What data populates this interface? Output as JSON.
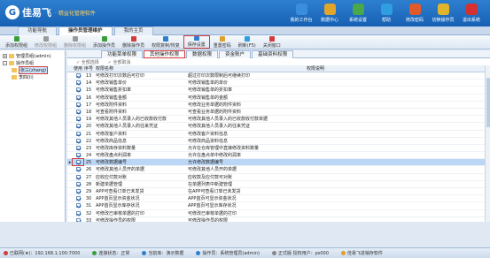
{
  "header": {
    "logo_mark": "G",
    "app_name": "佳易飞",
    "slogan": "· 精益化管理软件",
    "nav": [
      {
        "label": "我的工作台",
        "color": "#3b8de0"
      },
      {
        "label": "数据中心",
        "color": "#e2a52b"
      },
      {
        "label": "系统设置",
        "color": "#4aa84a"
      },
      {
        "label": "帮助",
        "color": "#2f9ee0"
      },
      {
        "label": "修改密码",
        "color": "#e05a2b"
      },
      {
        "label": "切换操作员",
        "color": "#e0b52b"
      },
      {
        "label": "退出系统",
        "color": "#d63030"
      }
    ]
  },
  "tabs": [
    "功能导航",
    "操作员管理维护",
    "我的主页"
  ],
  "toolbar": [
    {
      "label": "添加权限组",
      "dim": false,
      "color": "#3a9d3a"
    },
    {
      "label": "修改权限组",
      "dim": true,
      "color": "#9a9a9a"
    },
    {
      "label": "删除权限组",
      "dim": true,
      "color": "#9a9a9a"
    },
    {
      "label": "添加操作员",
      "dim": false,
      "color": "#3a9d3a"
    },
    {
      "label": "删除操作员",
      "dim": false,
      "color": "#d43c3c"
    },
    {
      "label": "权限复制/恢复",
      "dim": false,
      "color": "#2f7fd0"
    },
    {
      "label": "保存设置",
      "dim": false,
      "color": "#2f7fd0",
      "boxed": true
    },
    {
      "label": "重置密码",
      "dim": false,
      "color": "#e0a02b"
    },
    {
      "label": "刷新(F5)",
      "dim": false,
      "color": "#2f9ee0"
    },
    {
      "label": "关闭窗口",
      "dim": false,
      "color": "#d43c3c"
    }
  ],
  "tree": [
    {
      "label": "管理员组(admin)",
      "level": 0,
      "expander": "+"
    },
    {
      "label": "操作员组",
      "level": 0,
      "expander": "-"
    },
    {
      "label": "张三(zhang)",
      "level": 1,
      "expander": "",
      "selected": true
    },
    {
      "label": "李四(li)",
      "level": 1,
      "expander": ""
    }
  ],
  "subtabs": [
    "功能菜单权限",
    "其他操作权限",
    "数据权限",
    "资金账户",
    "基础资料权限"
  ],
  "subbar": [
    "全部选择",
    "全部取消"
  ],
  "columns": {
    "c0": "",
    "c1": "使用",
    "c2": "序号",
    "c3": "权限名称",
    "c4": "",
    "c5": "权限说明"
  },
  "rows": [
    {
      "no": "13",
      "name": "可修改打印次数后可打印",
      "desc": "超过打印次数限制后可继续打印",
      "on": true
    },
    {
      "no": "14",
      "name": "可修改销售单价",
      "desc": "可修改销售单的单价",
      "on": true
    },
    {
      "no": "15",
      "name": "可修改销售折扣率",
      "desc": "可修改销售单的折扣率",
      "on": true
    },
    {
      "no": "16",
      "name": "可修改销售金额",
      "desc": "可修改销售单的金额",
      "on": true
    },
    {
      "no": "17",
      "name": "可修改附件资料",
      "desc": "可修改业务单据的附件资料",
      "on": true
    },
    {
      "no": "18",
      "name": "可查看附件资料",
      "desc": "可查看业务单据的附件资料",
      "on": true
    },
    {
      "no": "19",
      "name": "可修改其他人员录入的已收款收付款",
      "desc": "可修改其他人员录入的已收款收付款单据",
      "on": true
    },
    {
      "no": "20",
      "name": "可修改其他人员录入的往来凭证",
      "desc": "可修改其他人员录入的往来凭证",
      "on": true
    },
    {
      "no": "21",
      "name": "可修改客户资料",
      "desc": "可修改客户资料信息",
      "on": true
    },
    {
      "no": "22",
      "name": "可修改商品信息",
      "desc": "可修改商品资料信息",
      "on": true
    },
    {
      "no": "23",
      "name": "可修改库存资料数量",
      "desc": "允许在仓库管理中直接修改资料数量",
      "on": true
    },
    {
      "no": "24",
      "name": "可修改盘点利润率",
      "desc": "允许在盘点单中修改利润率",
      "on": true
    },
    {
      "no": "25",
      "name": "可修改数据编号",
      "desc": "允许修改数据编号",
      "on": true,
      "selected": true
    },
    {
      "no": "26",
      "name": "可修改其他人员开的单据",
      "desc": "可修改其他人员开的单据",
      "on": true
    },
    {
      "no": "27",
      "name": "应收应付款对账",
      "desc": "应收款及应付款可对账",
      "on": true
    },
    {
      "no": "28",
      "name": "新建单据管理",
      "desc": "在单据列表中新建管理",
      "on": true
    },
    {
      "no": "29",
      "name": "APP可查看订单已未发货",
      "desc": "在APP可查看订单已未发货",
      "on": true
    },
    {
      "no": "30",
      "name": "APP首页显示资金状况",
      "desc": "APP首页可显示资金状况",
      "on": true
    },
    {
      "no": "31",
      "name": "APP首页显示库存状况",
      "desc": "APP首页可显示库存状况",
      "on": true
    },
    {
      "no": "32",
      "name": "可修改已审核单据的打印",
      "desc": "可修改已审核单据的打印",
      "on": true
    },
    {
      "no": "33",
      "name": "可修改操作员的权限",
      "desc": "可修改操作员的权限",
      "on": true
    }
  ],
  "status": [
    {
      "label": "已联网(★)：192.168.1.100:7000",
      "color": "#d43c3c"
    },
    {
      "label": "连接状态：正常",
      "color": "#3a9d3a"
    },
    {
      "label": "当前库：演示数据",
      "color": "#2f7fd0"
    },
    {
      "label": "操作员：系统管理员(admin)",
      "color": "#2f7fd0"
    },
    {
      "label": "正式版 授权用户：ps000",
      "color": "#888888"
    },
    {
      "label": "佳易飞进销存软件",
      "color": "#e0a02b"
    }
  ]
}
